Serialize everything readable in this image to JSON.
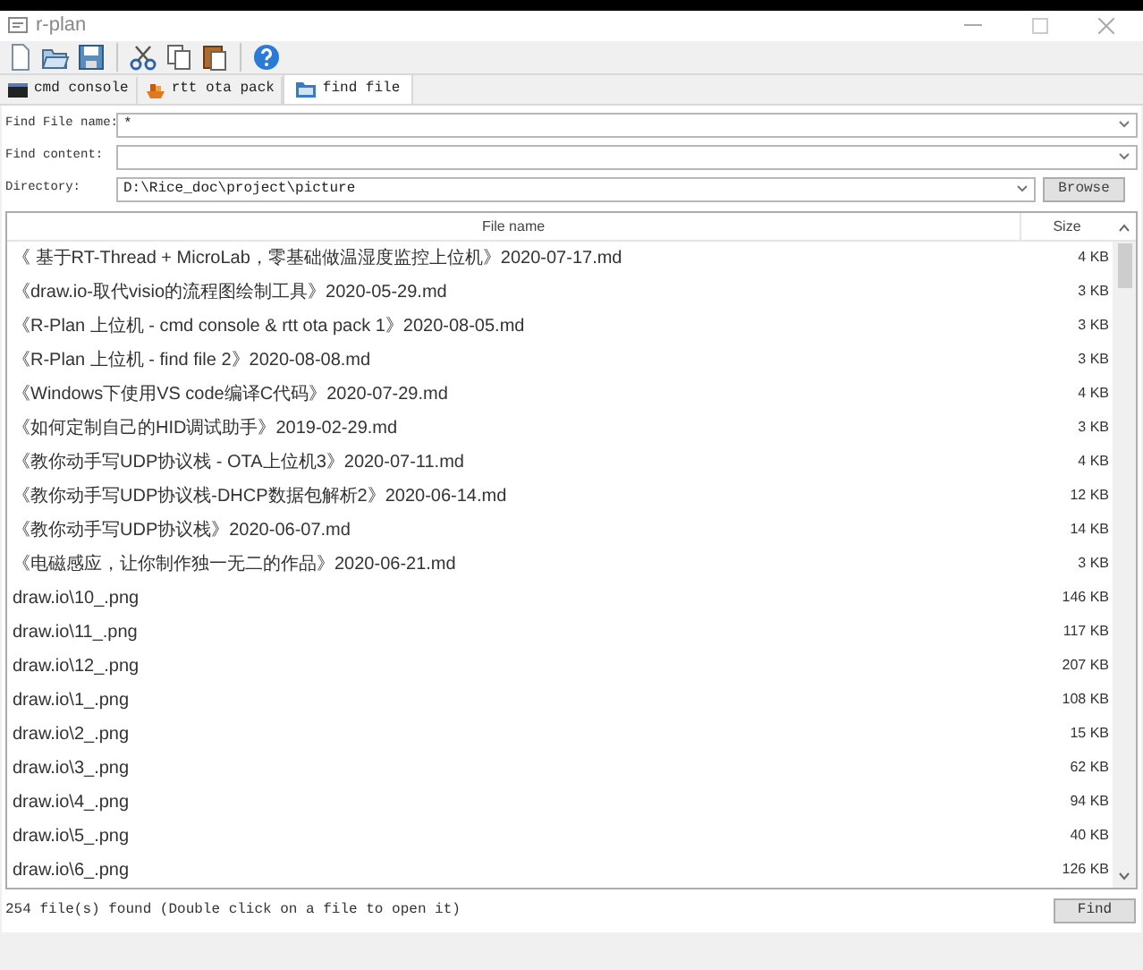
{
  "window": {
    "title": "r-plan"
  },
  "tabs": [
    {
      "label": "cmd console",
      "selected": false
    },
    {
      "label": "rtt ota pack",
      "selected": false
    },
    {
      "label": "find file",
      "selected": true
    }
  ],
  "form": {
    "find_file_name": {
      "label": "Find File name:",
      "value": "*"
    },
    "find_content": {
      "label": "Find content:"
    },
    "directory": {
      "label": "Directory:",
      "value": "D:\\Rice_doc\\project\\picture"
    },
    "browse_button": "Browse"
  },
  "table": {
    "columns": [
      "File name",
      "Size"
    ],
    "rows": [
      {
        "name": "《 基于RT-Thread + MicroLab，零基础做温湿度监控上位机》2020-07-17.md",
        "size": "4 KB"
      },
      {
        "name": "《draw.io-取代visio的流程图绘制工具》2020-05-29.md",
        "size": "3 KB"
      },
      {
        "name": "《R-Plan 上位机 - cmd console & rtt ota pack 1》2020-08-05.md",
        "size": "3 KB"
      },
      {
        "name": "《R-Plan 上位机 - find file 2》2020-08-08.md",
        "size": "3 KB"
      },
      {
        "name": "《Windows下使用VS code编译C代码》2020-07-29.md",
        "size": "4 KB"
      },
      {
        "name": "《如何定制自己的HID调试助手》2019-02-29.md",
        "size": "3 KB"
      },
      {
        "name": "《教你动手写UDP协议栈 - OTA上位机3》2020-07-11.md",
        "size": "4 KB"
      },
      {
        "name": "《教你动手写UDP协议栈-DHCP数据包解析2》2020-06-14.md",
        "size": "12 KB"
      },
      {
        "name": "《教你动手写UDP协议栈》2020-06-07.md",
        "size": "14 KB"
      },
      {
        "name": "《电磁感应，让你制作独一无二的作品》2020-06-21.md",
        "size": "3 KB"
      },
      {
        "name": "draw.io\\10_.png",
        "size": "146 KB"
      },
      {
        "name": "draw.io\\11_.png",
        "size": "117 KB"
      },
      {
        "name": "draw.io\\12_.png",
        "size": "207 KB"
      },
      {
        "name": "draw.io\\1_.png",
        "size": "108 KB"
      },
      {
        "name": "draw.io\\2_.png",
        "size": "15 KB"
      },
      {
        "name": "draw.io\\3_.png",
        "size": "62 KB"
      },
      {
        "name": "draw.io\\4_.png",
        "size": "94 KB"
      },
      {
        "name": "draw.io\\5_.png",
        "size": "40 KB"
      },
      {
        "name": "draw.io\\6_.png",
        "size": "126 KB"
      }
    ]
  },
  "status_bar": {
    "text": "254 file(s) found (Double click on a file to open it)",
    "find_button": "Find"
  }
}
